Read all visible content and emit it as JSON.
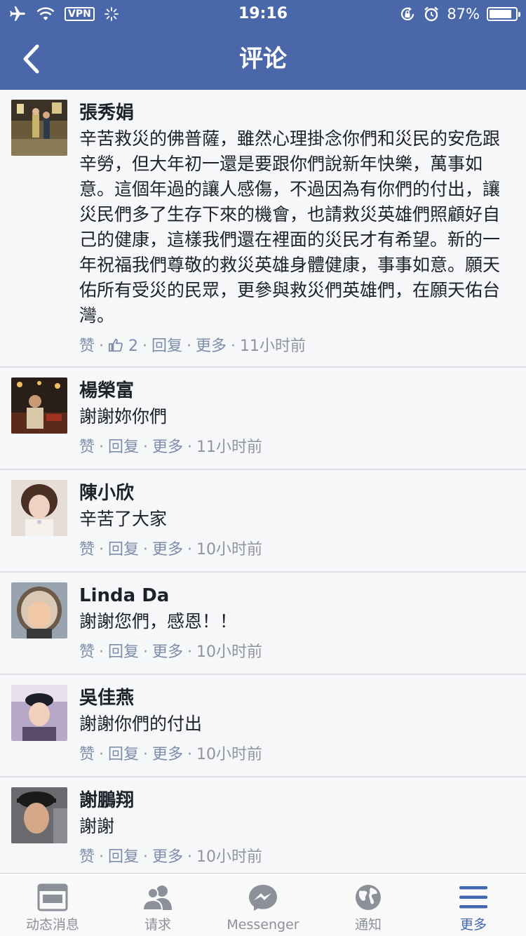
{
  "status_bar": {
    "vpn": "VPN",
    "time": "19:16",
    "battery": "87%",
    "battery_level": 0.87
  },
  "nav": {
    "title": "评论"
  },
  "comments": [
    {
      "name": "張秀娟",
      "text": "辛苦救災的佛普薩，雖然心理掛念你們和災民的安危跟辛勞，但大年初一還是要跟你們說新年快樂，萬事如意。這個年過的讓人感傷，不過因為有你們的付出，讓災民們多了生存下來的機會，也請救災英雄們照顧好自己的健康，這樣我們還在裡面的災民才有希望。新的一年祝福我們尊敬的救災英雄身體健康，事事如意。願天佑所有受災的民眾，更參與救災們英雄們，在願天佑台灣。",
      "like": "赞",
      "likes_count": "2",
      "reply": "回复",
      "more": "更多",
      "time": "11小时前"
    },
    {
      "name": "楊榮富",
      "text": "謝謝妳你們",
      "like": "赞",
      "reply": "回复",
      "more": "更多",
      "time": "11小时前"
    },
    {
      "name": "陳小欣",
      "text": "辛苦了大家",
      "like": "赞",
      "reply": "回复",
      "more": "更多",
      "time": "10小时前"
    },
    {
      "name": "Linda Da",
      "text": "謝謝您們，感恩！！",
      "like": "赞",
      "reply": "回复",
      "more": "更多",
      "time": "10小时前"
    },
    {
      "name": "吳佳燕",
      "text": "謝謝你們的付出",
      "like": "赞",
      "reply": "回复",
      "more": "更多",
      "time": "10小时前"
    },
    {
      "name": "謝鵬翔",
      "text": "謝謝",
      "like": "赞",
      "reply": "回复",
      "more": "更多",
      "time": "10小时前"
    }
  ],
  "tabs": [
    {
      "label": "动态消息",
      "icon": "news-feed-icon"
    },
    {
      "label": "请求",
      "icon": "friend-requests-icon"
    },
    {
      "label": "Messenger",
      "icon": "messenger-icon"
    },
    {
      "label": "通知",
      "icon": "globe-icon"
    },
    {
      "label": "更多",
      "icon": "menu-icon",
      "active": true
    }
  ],
  "colors": {
    "header": "#4967a9",
    "background": "#e9ebee",
    "comment_background": "#f6f7f9",
    "active_tab": "#4267b2"
  }
}
